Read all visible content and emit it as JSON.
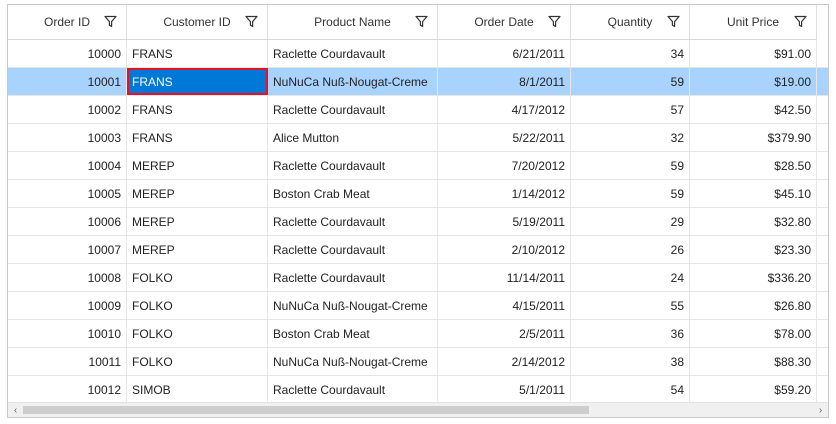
{
  "columns": [
    {
      "label": "Order ID"
    },
    {
      "label": "Customer ID"
    },
    {
      "label": "Product Name"
    },
    {
      "label": "Order Date"
    },
    {
      "label": "Quantity"
    },
    {
      "label": "Unit Price"
    }
  ],
  "rows": [
    {
      "order_id": "10000",
      "customer_id": "FRANS",
      "product": "Raclette Courdavault",
      "date": "6/21/2011",
      "quantity": "34",
      "price": "$91.00"
    },
    {
      "order_id": "10001",
      "customer_id": "FRANS",
      "product": "NuNuCa Nuß-Nougat-Creme",
      "date": "8/1/2011",
      "quantity": "59",
      "price": "$19.00"
    },
    {
      "order_id": "10002",
      "customer_id": "FRANS",
      "product": "Raclette Courdavault",
      "date": "4/17/2012",
      "quantity": "57",
      "price": "$42.50"
    },
    {
      "order_id": "10003",
      "customer_id": "FRANS",
      "product": "Alice Mutton",
      "date": "5/22/2011",
      "quantity": "32",
      "price": "$379.90"
    },
    {
      "order_id": "10004",
      "customer_id": "MEREP",
      "product": "Raclette Courdavault",
      "date": "7/20/2012",
      "quantity": "59",
      "price": "$28.50"
    },
    {
      "order_id": "10005",
      "customer_id": "MEREP",
      "product": "Boston Crab Meat",
      "date": "1/14/2012",
      "quantity": "59",
      "price": "$45.10"
    },
    {
      "order_id": "10006",
      "customer_id": "MEREP",
      "product": "Raclette Courdavault",
      "date": "5/19/2011",
      "quantity": "29",
      "price": "$32.80"
    },
    {
      "order_id": "10007",
      "customer_id": "MEREP",
      "product": "Raclette Courdavault",
      "date": "2/10/2012",
      "quantity": "26",
      "price": "$23.30"
    },
    {
      "order_id": "10008",
      "customer_id": "FOLKO",
      "product": "Raclette Courdavault",
      "date": "11/14/2011",
      "quantity": "24",
      "price": "$336.20"
    },
    {
      "order_id": "10009",
      "customer_id": "FOLKO",
      "product": "NuNuCa Nuß-Nougat-Creme",
      "date": "4/15/2011",
      "quantity": "55",
      "price": "$26.80"
    },
    {
      "order_id": "10010",
      "customer_id": "FOLKO",
      "product": "Boston Crab Meat",
      "date": "2/5/2011",
      "quantity": "36",
      "price": "$78.00"
    },
    {
      "order_id": "10011",
      "customer_id": "FOLKO",
      "product": "NuNuCa Nuß-Nougat-Creme",
      "date": "2/14/2012",
      "quantity": "38",
      "price": "$88.30"
    },
    {
      "order_id": "10012",
      "customer_id": "SIMOB",
      "product": "Raclette Courdavault",
      "date": "5/1/2011",
      "quantity": "54",
      "price": "$59.20"
    }
  ],
  "selected_row_index": 1,
  "current_cell": {
    "row": 1,
    "column": "customer_id"
  },
  "colors": {
    "selected_row": "#a9d3ff",
    "current_cell": "#0078d7",
    "current_cell_border": "#e81123"
  },
  "icons": {
    "filter": "filter-funnel-icon",
    "scroll_left": "chevron-left-icon",
    "scroll_right": "chevron-right-icon"
  }
}
